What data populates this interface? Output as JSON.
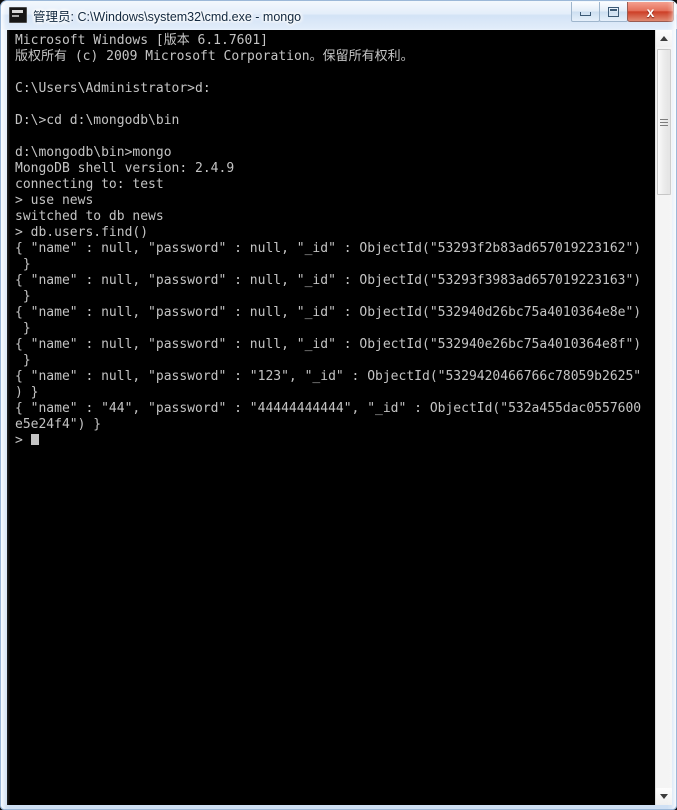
{
  "window": {
    "title": "管理员: C:\\Windows\\system32\\cmd.exe - mongo",
    "icon": "cmd-icon",
    "controls": {
      "minimize_label": "–",
      "maximize_label": "☐",
      "close_label": "x"
    },
    "colors": {
      "frame": "#cfe0f4",
      "titlebar_text": "#12283f",
      "console_bg": "#000000",
      "console_text": "#c4c4c4",
      "close_button": "#cd3f27"
    }
  },
  "console": {
    "prompt_symbol": ">",
    "cursor": "block",
    "lines": [
      "Microsoft Windows [版本 6.1.7601]",
      "版权所有 (c) 2009 Microsoft Corporation。保留所有权利。",
      "",
      "C:\\Users\\Administrator>d:",
      "",
      "D:\\>cd d:\\mongodb\\bin",
      "",
      "d:\\mongodb\\bin>mongo",
      "MongoDB shell version: 2.4.9",
      "connecting to: test",
      "> use news",
      "switched to db news",
      "> db.users.find()",
      "{ \"name\" : null, \"password\" : null, \"_id\" : ObjectId(\"53293f2b83ad657019223162\")",
      " }",
      "{ \"name\" : null, \"password\" : null, \"_id\" : ObjectId(\"53293f3983ad657019223163\")",
      " }",
      "{ \"name\" : null, \"password\" : null, \"_id\" : ObjectId(\"532940d26bc75a4010364e8e\")",
      " }",
      "{ \"name\" : null, \"password\" : null, \"_id\" : ObjectId(\"532940e26bc75a4010364e8f\")",
      " }",
      "{ \"name\" : null, \"password\" : \"123\", \"_id\" : ObjectId(\"5329420466766c78059b2625\"",
      ") }",
      "{ \"name\" : \"44\", \"password\" : \"44444444444\", \"_id\" : ObjectId(\"532a455dac0557600",
      "e5e24f4\") }"
    ],
    "last_prompt": ">"
  },
  "scrollbar": {
    "up_arrow": "scroll-up-icon",
    "down_arrow": "scroll-down-icon",
    "thumb": "scroll-thumb"
  }
}
